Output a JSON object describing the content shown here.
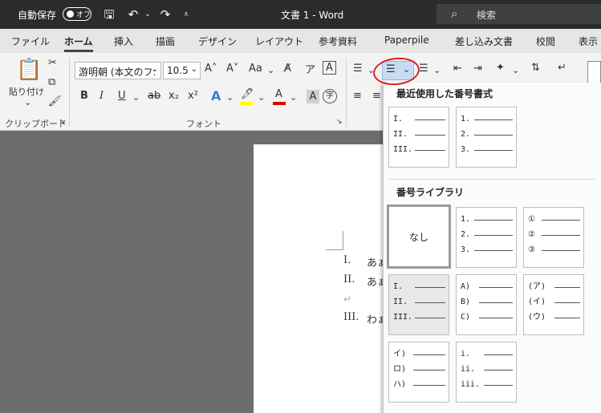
{
  "titlebar": {
    "autosave_label": "自動保存",
    "autosave_toggle": "オフ",
    "doc_title": "文書 1  -  Word",
    "search_placeholder": "検索"
  },
  "tabs": [
    "ファイル",
    "ホーム",
    "挿入",
    "描画",
    "デザイン",
    "レイアウト",
    "参考資料",
    "Paperpile",
    "差し込み文書",
    "校閲",
    "表示"
  ],
  "active_tab": "ホーム",
  "ribbon": {
    "paste_label": "貼り付け",
    "clipboard_group": "クリップボード",
    "font_group": "フォント",
    "font_name": "游明朝 (本文のフ:",
    "font_size": "10.5",
    "grow_font": "A˄",
    "shrink_font": "A˅",
    "change_case": "Aa",
    "bold": "B",
    "italic": "I",
    "underline": "U",
    "strikethrough": "ab",
    "subscript": "x₂",
    "superscript": "x²",
    "text_effect": "A",
    "highlight": "ab",
    "font_color": "A",
    "char_shading": "A",
    "enclose": "字"
  },
  "document": {
    "lines": [
      {
        "num": "I.",
        "text": "あぁ"
      },
      {
        "num": "II.",
        "text": "あぁ"
      },
      {
        "num": "III.",
        "text": "わぁ"
      }
    ],
    "para_mark": "↵"
  },
  "numbering_panel": {
    "recent_heading": "最近使用した番号書式",
    "library_heading": "番号ライブラリ",
    "recent": [
      [
        "I.",
        "II.",
        "III."
      ],
      [
        "1.",
        "2.",
        "3."
      ]
    ],
    "none_label": "なし",
    "library": [
      [
        "1.",
        "2.",
        "3."
      ],
      [
        "①",
        "②",
        "③"
      ],
      [
        "I.",
        "II.",
        "III."
      ],
      [
        "A)",
        "B)",
        "C)"
      ],
      [
        "(ア)",
        "(イ)",
        "(ウ)"
      ],
      [
        "イ)",
        "ロ)",
        "ハ)"
      ],
      [
        "i.",
        "ii.",
        "iii."
      ]
    ]
  },
  "colors": {
    "titlebar": "#2b2b2b",
    "highlight_bar": "#ffff00",
    "font_color_bar": "#e00000",
    "annotation_circle": "#e02020"
  }
}
